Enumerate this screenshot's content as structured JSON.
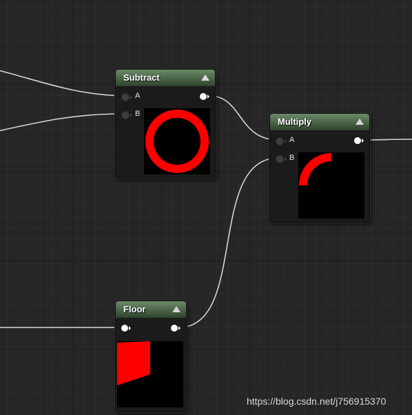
{
  "graph": {
    "background_color": "#262626",
    "wire_color": "#d6d6d6"
  },
  "nodes": {
    "subtract": {
      "title": "Subtract",
      "inputs": [
        "A",
        "B"
      ],
      "preview_shape": "ring"
    },
    "multiply": {
      "title": "Multiply",
      "inputs": [
        "A",
        "B"
      ],
      "preview_shape": "quarter-arc"
    },
    "floor": {
      "title": "Floor",
      "inputs": [],
      "preview_shape": "quad"
    }
  },
  "preview_color": "#ff0000",
  "header_color": "#4f6a4c",
  "watermark": "https://blog.csdn.net/j756915370"
}
